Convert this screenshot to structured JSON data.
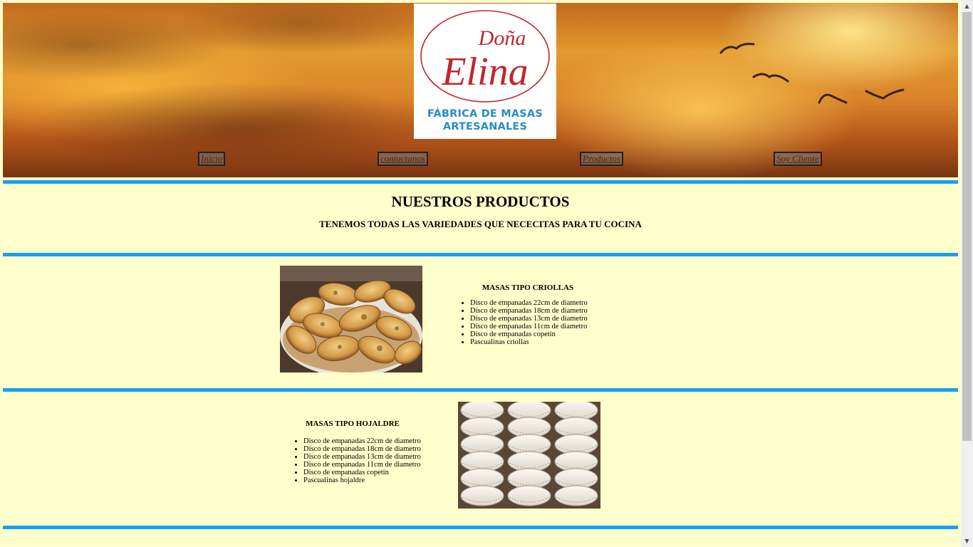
{
  "header": {
    "logo": {
      "script_line1": "Doña",
      "script_line2": "Elina",
      "subtitle_line1": "FÁBRICA DE MASAS",
      "subtitle_line2": "ARTESANALES",
      "script_color": "#c0262c",
      "subtitle_color": "#2a8cc0"
    },
    "nav": [
      {
        "label": "Inicio"
      },
      {
        "label": "contactanos"
      },
      {
        "label": "Productos"
      },
      {
        "label": "Soy Cliente"
      }
    ]
  },
  "main": {
    "title": "NUESTROS PRODUCTOS",
    "subtitle": "TENEMOS TODAS LAS VARIEDADES QUE NECECITAS PARA TU COCINA",
    "products": [
      {
        "title": "MASAS TIPO CRIOLLAS",
        "items": [
          "Disco de empanadas 22cm de diametro",
          "Disco de empanadas 18cm de diametro",
          "Disco de empanadas 13cm de diametro",
          "Disco de empanadas 11cm de diametro",
          "Disco de empanadas copetín",
          "Pascualinas criollas"
        ]
      },
      {
        "title": "MASAS TIPO HOJALDRE",
        "items": [
          "Disco de empanadas 22cm de diametro",
          "Disco de empanadas 18cm de diametro",
          "Disco de empanadas 13cm de diametro",
          "Disco de empanadas 11cm de diametro",
          "Disco de empanadas copetín",
          "Pascualinas hojaldre"
        ]
      }
    ]
  },
  "colors": {
    "page_background": "#ffffcc",
    "separator": "#1a9ff0"
  }
}
